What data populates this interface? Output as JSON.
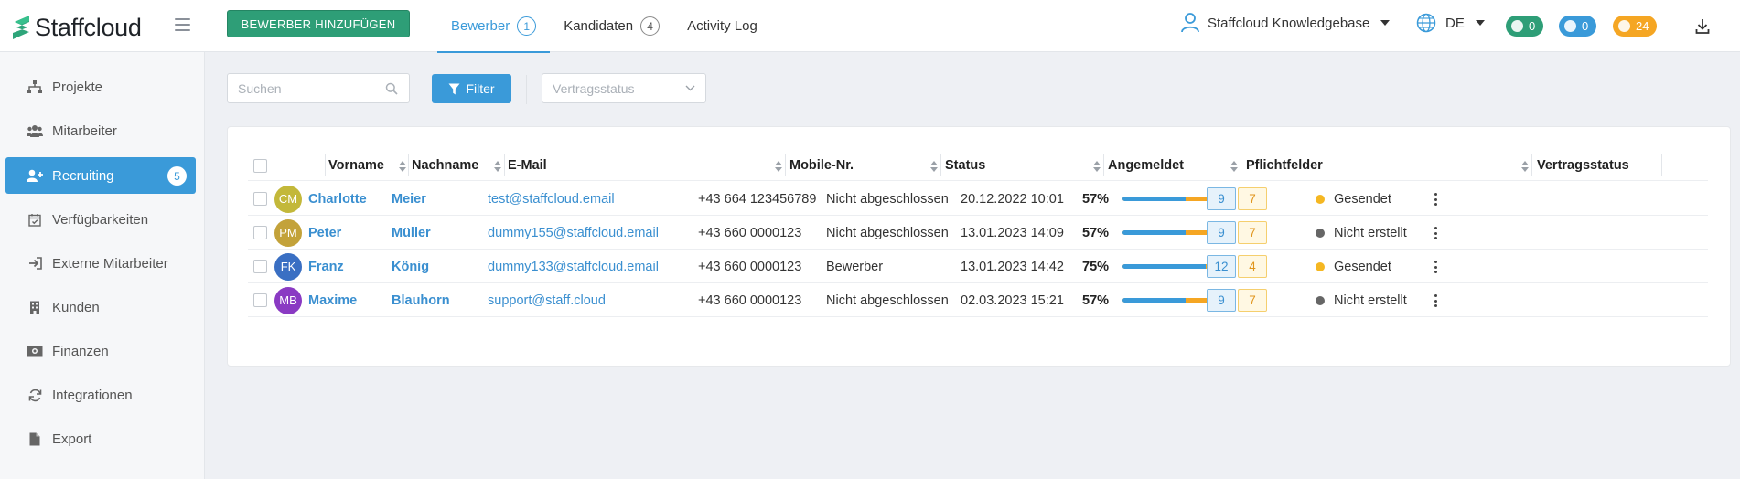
{
  "header": {
    "brand": "Staffcloud",
    "add_button": "BEWERBER HINZUFÜGEN",
    "tabs": [
      {
        "label": "Bewerber",
        "count": "1",
        "active": true
      },
      {
        "label": "Kandidaten",
        "count": "4",
        "active": false
      },
      {
        "label": "Activity Log",
        "count": "",
        "active": false
      }
    ],
    "user": "Staffcloud Knowledgebase",
    "language": "DE",
    "notifications": {
      "messages": "0",
      "alerts": "0",
      "reminders": "24"
    }
  },
  "sidebar": {
    "items": [
      {
        "label": "Projekte",
        "icon": "sitemap-icon"
      },
      {
        "label": "Mitarbeiter",
        "icon": "users-icon"
      },
      {
        "label": "Recruiting",
        "icon": "user-plus-icon",
        "badge": "5",
        "active": true
      },
      {
        "label": "Verfügbarkeiten",
        "icon": "calendar-check-icon"
      },
      {
        "label": "Externe Mitarbeiter",
        "icon": "sign-in-icon"
      },
      {
        "label": "Kunden",
        "icon": "building-icon"
      },
      {
        "label": "Finanzen",
        "icon": "money-icon"
      },
      {
        "label": "Integrationen",
        "icon": "sync-icon"
      },
      {
        "label": "Export",
        "icon": "file-icon"
      }
    ]
  },
  "toolbar": {
    "search_placeholder": "Suchen",
    "filter_label": "Filter",
    "contract_select_placeholder": "Vertragsstatus"
  },
  "table": {
    "columns": [
      "Vorname",
      "Nachname",
      "E-Mail",
      "Mobile-Nr.",
      "Status",
      "Angemeldet",
      "Pflichtfelder",
      "Vertragsstatus"
    ],
    "rows": [
      {
        "initials": "CM",
        "avatar_color": "#c3b83a",
        "first": "Charlotte",
        "last": "Meier",
        "email": "test@staffcloud.email",
        "mobile": "+43 664 123456789",
        "status": "Nicht abgeschlossen",
        "registered": "20.12.2022 10:01",
        "percent": "57%",
        "progress": 0.57,
        "filled": "9",
        "missing": "7",
        "contract": "Gesendet",
        "contract_color": "#f5b722"
      },
      {
        "initials": "PM",
        "avatar_color": "#c3a23a",
        "first": "Peter",
        "last": "Müller",
        "email": "dummy155@staffcloud.email",
        "mobile": "+43 660 0000123",
        "status": "Nicht abgeschlossen",
        "registered": "13.01.2023 14:09",
        "percent": "57%",
        "progress": 0.57,
        "filled": "9",
        "missing": "7",
        "contract": "Nicht erstellt",
        "contract_color": "#666666"
      },
      {
        "initials": "FK",
        "avatar_color": "#3a6fc3",
        "first": "Franz",
        "last": "König",
        "email": "dummy133@staffcloud.email",
        "mobile": "+43 660 0000123",
        "status": "Bewerber",
        "registered": "13.01.2023 14:42",
        "percent": "75%",
        "progress": 0.75,
        "filled": "12",
        "missing": "4",
        "contract": "Gesendet",
        "contract_color": "#f5b722"
      },
      {
        "initials": "MB",
        "avatar_color": "#8a3ac3",
        "first": "Maxime",
        "last": "Blauhorn",
        "email": "support@staff.cloud",
        "mobile": "+43 660 0000123",
        "status": "Nicht abgeschlossen",
        "registered": "02.03.2023 15:21",
        "percent": "57%",
        "progress": 0.57,
        "filled": "9",
        "missing": "7",
        "contract": "Nicht erstellt",
        "contract_color": "#666666"
      }
    ]
  }
}
